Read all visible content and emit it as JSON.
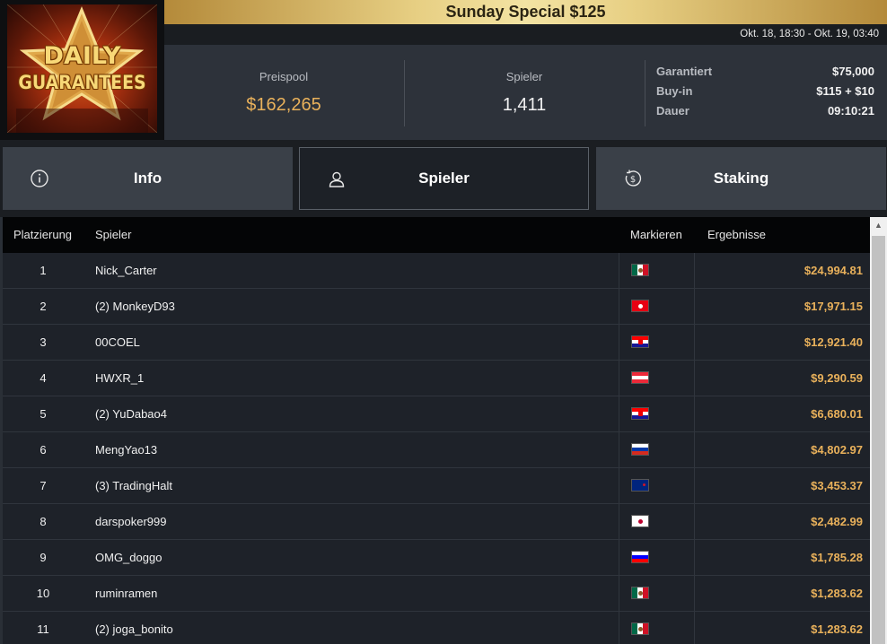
{
  "logo": {
    "line1": "DAILY",
    "line2": "GUARANTEES"
  },
  "tournament": {
    "title": "Sunday Special $125",
    "dates": "Okt. 18, 18:30 - Okt. 19, 03:40"
  },
  "stats": {
    "pool_label": "Preispool",
    "pool_value": "$162,265",
    "players_label": "Spieler",
    "players_value": "1,411",
    "details": [
      {
        "key": "Garantiert",
        "value": "$75,000"
      },
      {
        "key": "Buy-in",
        "value": "$115 + $10"
      },
      {
        "key": "Dauer",
        "value": "09:10:21"
      }
    ]
  },
  "tabs": [
    {
      "label": "Info",
      "icon": "info-icon"
    },
    {
      "label": "Spieler",
      "icon": "user-icon"
    },
    {
      "label": "Staking",
      "icon": "dollar-coin-icon"
    }
  ],
  "table": {
    "headers": {
      "rank": "Platzierung",
      "player": "Spieler",
      "flag": "Markieren",
      "result": "Ergebnisse"
    },
    "rows": [
      {
        "rank": "1",
        "player": "Nick_Carter",
        "flag": "mexico",
        "result": "$24,994.81"
      },
      {
        "rank": "2",
        "player": "(2) MonkeyD93",
        "flag": "tunisia",
        "result": "$17,971.15"
      },
      {
        "rank": "3",
        "player": "00COEL",
        "flag": "croatia",
        "result": "$12,921.40"
      },
      {
        "rank": "4",
        "player": "HWXR_1",
        "flag": "austria",
        "result": "$9,290.59"
      },
      {
        "rank": "5",
        "player": "(2) YuDabao4",
        "flag": "croatia",
        "result": "$6,680.01"
      },
      {
        "rank": "6",
        "player": "MengYao13",
        "flag": "russia",
        "result": "$4,802.97"
      },
      {
        "rank": "7",
        "player": "(3) TradingHalt",
        "flag": "new-zealand",
        "result": "$3,453.37"
      },
      {
        "rank": "8",
        "player": "darspoker999",
        "flag": "japan",
        "result": "$2,482.99"
      },
      {
        "rank": "9",
        "player": "OMG_doggo",
        "flag": "slovenia",
        "result": "$1,785.28"
      },
      {
        "rank": "10",
        "player": "ruminramen",
        "flag": "mexico",
        "result": "$1,283.62"
      },
      {
        "rank": "11",
        "player": "(2) joga_bonito",
        "flag": "mexico",
        "result": "$1,283.62"
      }
    ]
  },
  "colors": {
    "accent_gold": "#e9b15b",
    "title_gold": "#e7cf83",
    "bg_dark": "#1e2229"
  }
}
